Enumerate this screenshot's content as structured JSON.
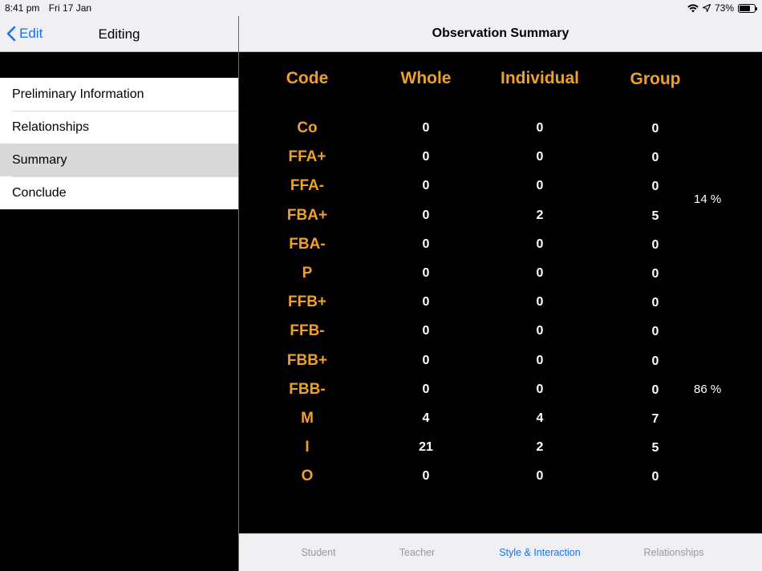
{
  "status": {
    "time": "8:41 pm",
    "date": "Fri 17 Jan",
    "battery_pct": "73%",
    "battery_level": 0.73
  },
  "left": {
    "back_label": "Edit",
    "title": "Editing",
    "menu": [
      {
        "label": "Preliminary Information"
      },
      {
        "label": "Relationships"
      },
      {
        "label": "Summary"
      },
      {
        "label": "Conclude"
      }
    ],
    "selected_index": 2
  },
  "right": {
    "title": "Observation Summary"
  },
  "table": {
    "headers": {
      "code": "Code",
      "whole": "Whole",
      "individual": "Individual",
      "group": "Group"
    },
    "rows": [
      {
        "code": "Co",
        "whole": "0",
        "individual": "0",
        "group": "0"
      },
      {
        "code": "FFA+",
        "whole": "0",
        "individual": "0",
        "group": "0"
      },
      {
        "code": "FFA-",
        "whole": "0",
        "individual": "0",
        "group": "0"
      },
      {
        "code": "FBA+",
        "whole": "0",
        "individual": "2",
        "group": "5"
      },
      {
        "code": "FBA-",
        "whole": "0",
        "individual": "0",
        "group": "0"
      },
      {
        "code": "P",
        "whole": "0",
        "individual": "0",
        "group": "0"
      },
      {
        "code": "FFB+",
        "whole": "0",
        "individual": "0",
        "group": "0"
      },
      {
        "code": "FFB-",
        "whole": "0",
        "individual": "0",
        "group": "0"
      },
      {
        "code": "FBB+",
        "whole": "0",
        "individual": "0",
        "group": "0"
      },
      {
        "code": "FBB-",
        "whole": "0",
        "individual": "0",
        "group": "0"
      },
      {
        "code": "M",
        "whole": "4",
        "individual": "4",
        "group": "7"
      },
      {
        "code": "I",
        "whole": "21",
        "individual": "2",
        "group": "5"
      },
      {
        "code": "O",
        "whole": "0",
        "individual": "0",
        "group": "0"
      }
    ],
    "percentages": {
      "top": "14 %",
      "bottom": "86 %"
    }
  },
  "tabs": [
    {
      "label": "Student"
    },
    {
      "label": "Teacher"
    },
    {
      "label": "Style & Interaction"
    },
    {
      "label": "Relationships"
    }
  ],
  "active_tab": 2,
  "colors": {
    "accent": "#f0a02a",
    "link": "#1a73e8",
    "background": "#000000"
  }
}
